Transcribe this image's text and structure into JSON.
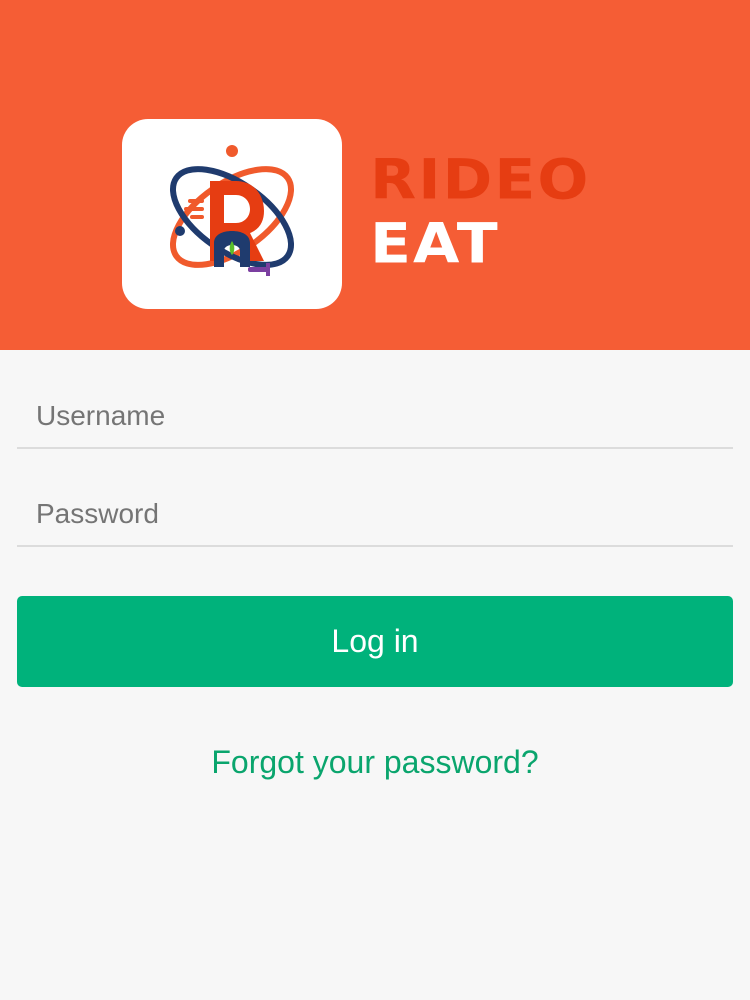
{
  "brand": {
    "line1": "RIDEO",
    "line2": "EAT",
    "header_color": "#f55d35",
    "accent_color": "#e63d12"
  },
  "form": {
    "username_placeholder": "Username",
    "username_value": "",
    "password_placeholder": "Password",
    "password_value": "",
    "login_label": "Log in",
    "forgot_label": "Forgot your password?",
    "button_color": "#00b27b",
    "link_color": "#0aa56d"
  },
  "icons": {
    "logo": "rideo-eat-logo-icon"
  }
}
